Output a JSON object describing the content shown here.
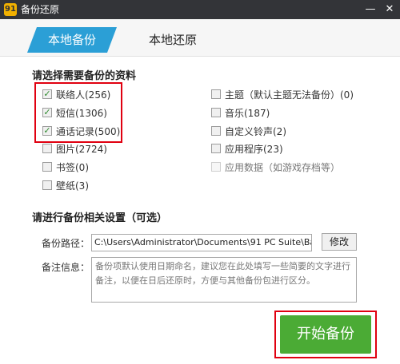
{
  "window": {
    "title": "备份还原",
    "app_icon_glyph": "91"
  },
  "tabs": [
    {
      "label": "本地备份",
      "active": true
    },
    {
      "label": "本地还原",
      "active": false
    }
  ],
  "backup_section": {
    "title": "请选择需要备份的资料",
    "left_items": [
      {
        "label": "联络人(256)",
        "checked": true
      },
      {
        "label": "短信(1306)",
        "checked": true
      },
      {
        "label": "通话记录(500)",
        "checked": true
      },
      {
        "label": "图片(2724)",
        "checked": false
      },
      {
        "label": "书签(0)",
        "checked": false
      },
      {
        "label": "壁纸(3)",
        "checked": false
      }
    ],
    "right_items": [
      {
        "label": "主题（默认主题无法备份）(0)",
        "checked": false
      },
      {
        "label": "音乐(187)",
        "checked": false
      },
      {
        "label": "自定义铃声(2)",
        "checked": false
      },
      {
        "label": "应用程序(23)",
        "checked": false
      },
      {
        "label": "应用数据（如游戏存档等）",
        "checked": false,
        "disabled": true
      }
    ]
  },
  "settings_section": {
    "title": "请进行备份相关设置（可选）",
    "path_label": "备份路径：",
    "path_value": "C:\\Users\\Administrator\\Documents\\91 PC Suite\\Ba",
    "modify_label": "修改",
    "note_label": "备注信息：",
    "note_placeholder": "备份项默认使用日期命名，建议您在此处填写一些简要的文字进行备注，以便在日后还原时，方便与其他备份包进行区分。"
  },
  "start_button": {
    "label": "开始备份"
  },
  "colors": {
    "accent": "#2b9fd6",
    "highlight": "#e00010",
    "start": "#4bab35"
  }
}
